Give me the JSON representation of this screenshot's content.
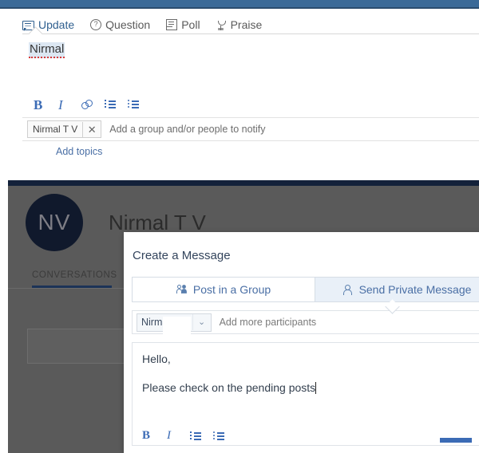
{
  "publisher": {
    "tabs": [
      {
        "label": "Update",
        "icon": "speech-bubble-icon",
        "active": true
      },
      {
        "label": "Question",
        "icon": "question-mark-icon",
        "active": false
      },
      {
        "label": "Poll",
        "icon": "poll-bars-icon",
        "active": false
      },
      {
        "label": "Praise",
        "icon": "trophy-icon",
        "active": false
      }
    ],
    "body_text": "Nirmal",
    "format_buttons": [
      {
        "name": "bold-button",
        "label": "B"
      },
      {
        "name": "italic-button",
        "label": "I"
      },
      {
        "name": "link-button",
        "label": ""
      },
      {
        "name": "numbered-list-button",
        "label": ""
      },
      {
        "name": "bulleted-list-button",
        "label": ""
      }
    ],
    "notify": {
      "chip_label": "Nirmal T V",
      "chip_remove": "✕",
      "placeholder": "Add a group and/or people to notify"
    },
    "add_topics_label": "Add topics"
  },
  "profile": {
    "avatar_initials": "NV",
    "name": "Nirmal T V",
    "tab_label": "CONVERSATIONS"
  },
  "modal": {
    "title": "Create a Message",
    "tabs": [
      {
        "label": "Post in a Group",
        "icon": "group-icon",
        "selected": false
      },
      {
        "label": "Send Private Message",
        "icon": "person-icon",
        "selected": true
      }
    ],
    "participants": {
      "chip_label": "Nirmal T V",
      "chip_caret": "⌄",
      "placeholder": "Add more participants"
    },
    "message": {
      "line1": "Hello,",
      "line2": "Please check on the pending posts"
    },
    "format_buttons": [
      {
        "name": "bold-button",
        "label": "B"
      },
      {
        "name": "italic-button",
        "label": "I"
      },
      {
        "name": "numbered-list-button",
        "label": ""
      },
      {
        "name": "bulleted-list-button",
        "label": ""
      }
    ]
  },
  "colors": {
    "top_strip": "#3b6a98",
    "accent_blue": "#3b6bb5",
    "link_blue": "#4a6fa5",
    "overlay_gray": "#5a5a5a",
    "dark_navy": "#13213a",
    "tab_selected_bg": "#e9f0f8"
  }
}
